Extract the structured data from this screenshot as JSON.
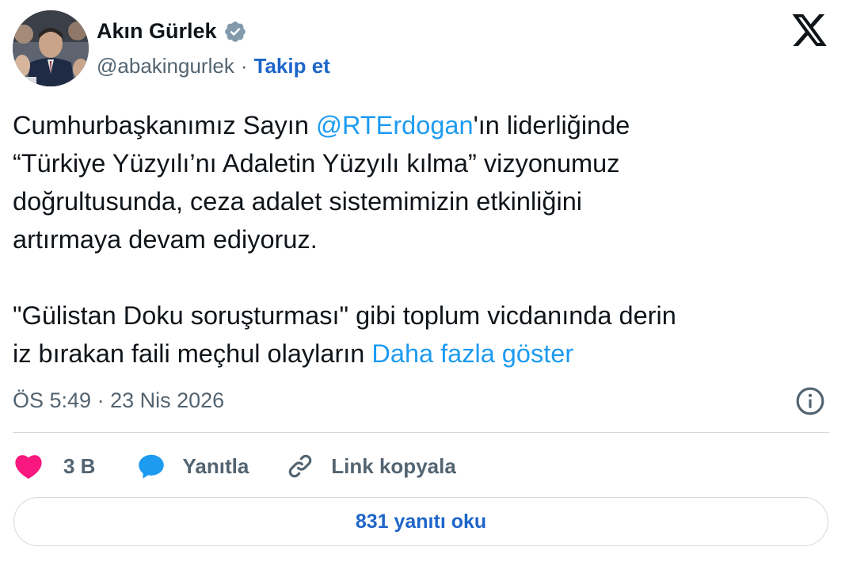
{
  "author": {
    "name": "Akın Gürlek",
    "handle": "@abakingurlek",
    "separator": "·",
    "follow_label": "Takip et"
  },
  "tweet": {
    "line1_before": "Cumhurbaşkanımız Sayın ",
    "mention": "@RTErdogan",
    "line1_after": "'ın liderliğinde",
    "line2": "“Türkiye Yüzyılı’nı Adaletin Yüzyılı kılma” vizyonumuz",
    "line3": "doğrultusunda, ceza adalet sistemimizin etkinliğini",
    "line4": "artırmaya devam ediyoruz.",
    "line5": "\"Gülistan Doku soruşturması\" gibi toplum vicdanında derin",
    "line6": "iz bırakan faili meçhul olayların ",
    "show_more": "Daha fazla göster"
  },
  "meta": {
    "time": "ÖS 5:49",
    "separator": "·",
    "date": "23 Nis 2026"
  },
  "actions": {
    "likes": "3 B",
    "reply": "Yanıtla",
    "copy_link": "Link kopyala"
  },
  "read_replies": "831 yanıtı oku",
  "colors": {
    "link": "#1d9bf0",
    "follow": "#1d65c9",
    "like": "#f91880",
    "verified": "#829aab",
    "muted": "#536471"
  },
  "icons": [
    "verified-badge-icon",
    "x-logo-icon",
    "info-icon",
    "heart-icon",
    "reply-bubble-icon",
    "link-icon"
  ]
}
